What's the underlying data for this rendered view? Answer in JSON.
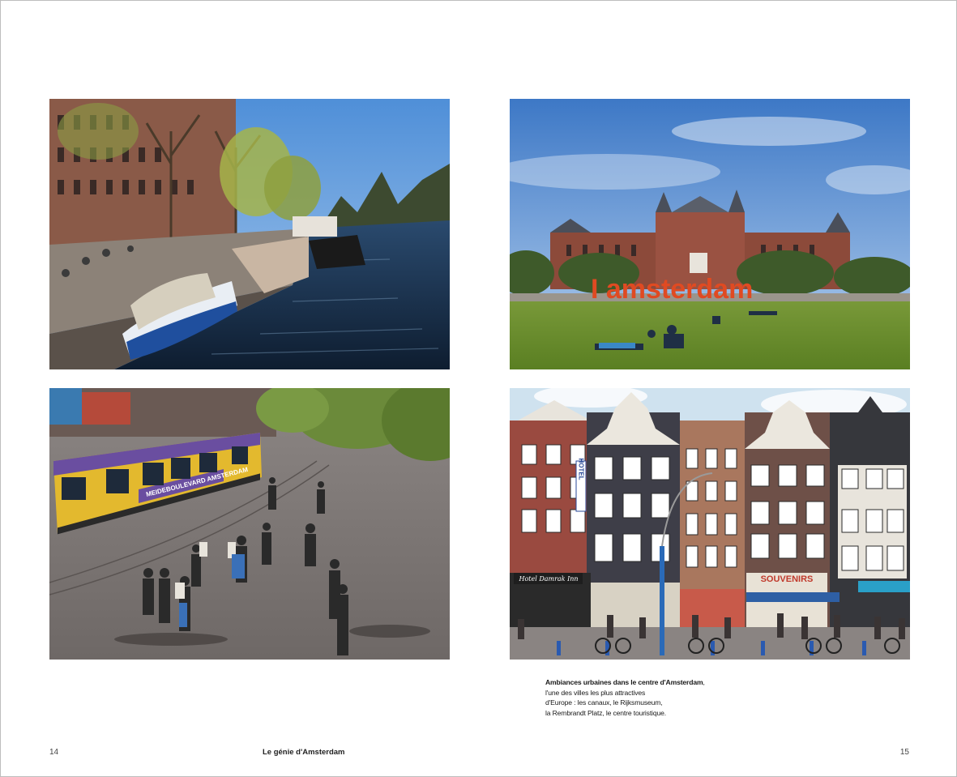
{
  "page": {
    "folio_left": "14",
    "folio_right": "15",
    "running_title": "Le génie d'Amsterdam"
  },
  "caption": {
    "lead": "Ambiances urbaines dans le centre d'Amsterdam",
    "rest_line1": ", l'une des villes les plus attractives",
    "rest_line2": "d'Europe : les canaux, le Rijksmuseum,",
    "rest_line3": "la Rembrandt Platz, le centre touristique."
  },
  "photos": {
    "museum_sign": "I amsterdam",
    "souvenir_sign": "SOUVENIRS",
    "hotel_sign": "Hotel Damrak Inn",
    "hotel_vertical": "HOTEL",
    "tram_banner": "MEIDEBOULEVARD AMSTERDAM"
  }
}
